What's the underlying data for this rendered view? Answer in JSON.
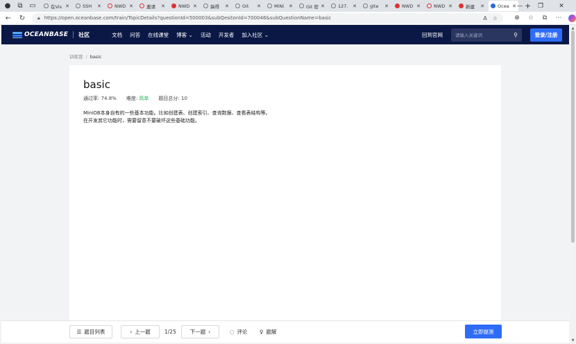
{
  "browser": {
    "tabs": [
      {
        "title": "在Vis",
        "icon": "globe"
      },
      {
        "title": "SSH",
        "icon": "globe"
      },
      {
        "title": "NWD",
        "icon": "red-circle"
      },
      {
        "title": "邀请",
        "icon": "red-circle"
      },
      {
        "title": "NWD",
        "icon": "g-logo"
      },
      {
        "title": "搞得",
        "icon": "search"
      },
      {
        "title": "Git",
        "icon": "globe"
      },
      {
        "title": "MiNi",
        "icon": "search"
      },
      {
        "title": "Git 密",
        "icon": "doc"
      },
      {
        "title": "127.",
        "icon": "doc"
      },
      {
        "title": "gite",
        "icon": "search"
      },
      {
        "title": "NWD",
        "icon": "g-logo"
      },
      {
        "title": "NWD",
        "icon": "red-circle"
      },
      {
        "title": "新建",
        "icon": "g-logo"
      },
      {
        "title": "Ocea",
        "icon": "oceanbase",
        "active": true
      }
    ],
    "new_tab": "+",
    "url": "https://open.oceanbase.com/train/TopicDetails?questionId=500003&subQesitonId=700046&subQuestionName=basic"
  },
  "header": {
    "brand": "OCEANBASE",
    "community": "社区",
    "nav": [
      "文档",
      "问答",
      "在线课堂",
      "博客 ⌄",
      "活动",
      "开发者",
      "加入社区 ⌄"
    ],
    "official_site": "回到官网",
    "search_placeholder": "请输入关键词",
    "login": "登录/注册"
  },
  "breadcrumb": {
    "parent": "训练营",
    "current": "basic"
  },
  "question": {
    "title": "basic",
    "pass_rate_label": "通过率: 74.8%",
    "difficulty_label": "难度: ",
    "difficulty_value": "简单",
    "score_label": "题目总分: 10",
    "desc_line1": "MiniOB本身自有的一些基本功能。比如创建表、创建索引、查询数据、查看表结构等。",
    "desc_line2": "在开发其它功能时，需要留意不要破坏这些基础功能。"
  },
  "footer": {
    "list_btn": "题目列表",
    "prev_btn": "上一题",
    "page": "1/25",
    "next_btn": "下一题",
    "comment": "评论",
    "solution": "题解",
    "submit": "立即提测"
  }
}
